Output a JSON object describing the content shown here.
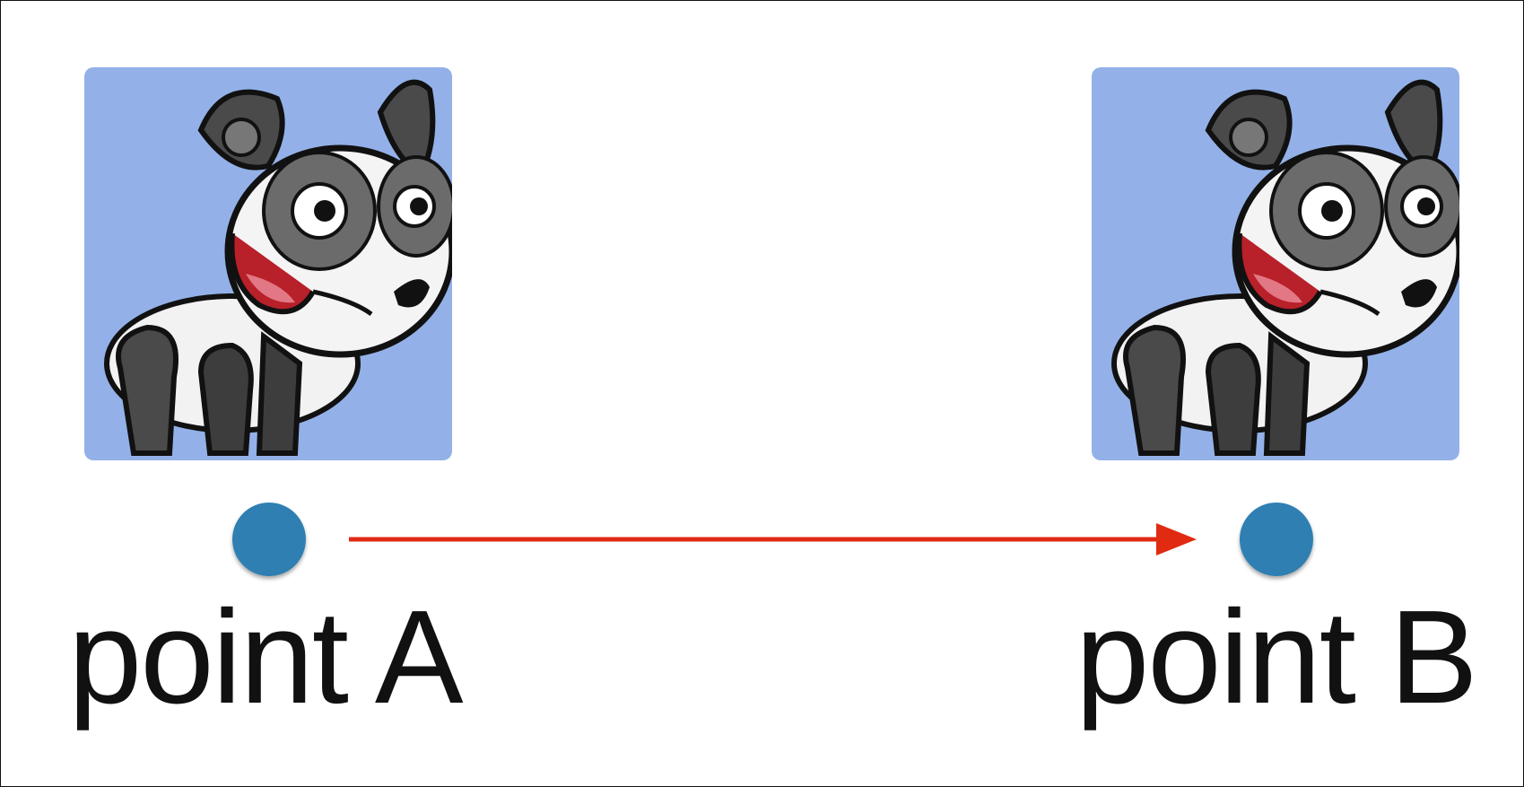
{
  "colors": {
    "card_background": "#93b1e8",
    "dot": "#2f7fb3",
    "arrow": "#e02a12",
    "text": "#111111"
  },
  "icons": {
    "sprite": "panda-icon",
    "dot": "point-marker-icon",
    "arrow": "arrow-right-icon"
  },
  "points": [
    {
      "label": "point A"
    },
    {
      "label": "point B"
    }
  ]
}
